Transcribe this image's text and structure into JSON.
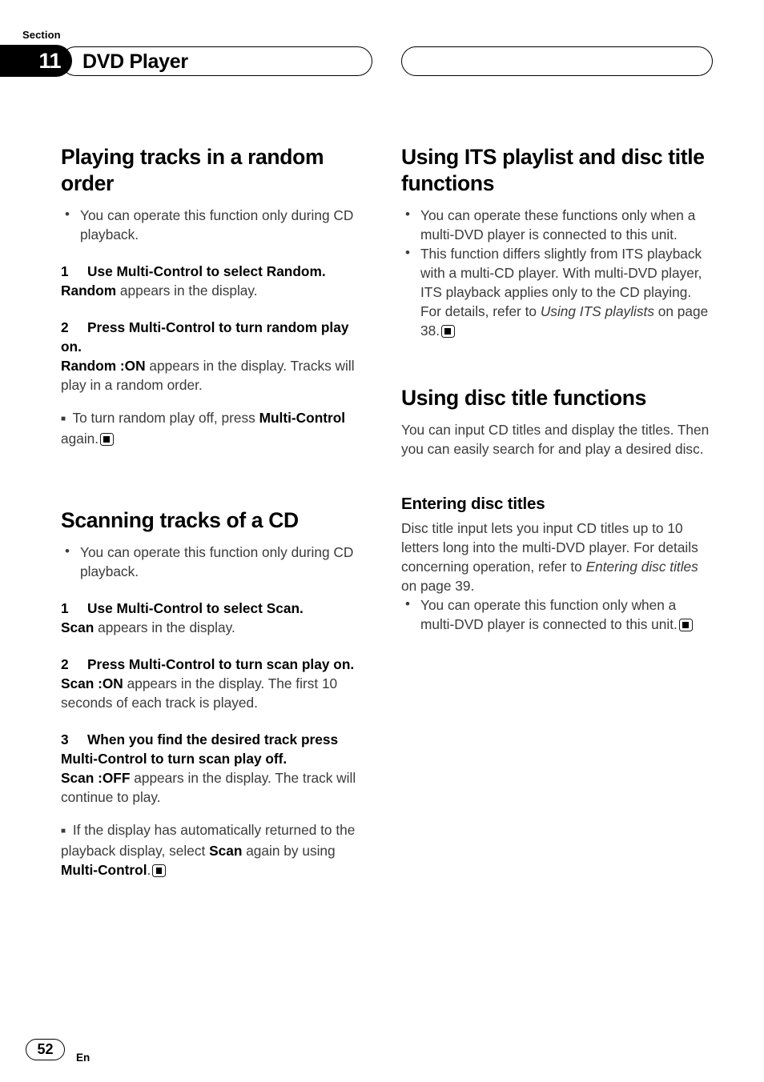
{
  "header": {
    "section_label": "Section",
    "section_number": "11",
    "chapter_title": "DVD Player",
    "right_pill_title": ""
  },
  "footer": {
    "page_number": "52",
    "language_code": "En"
  },
  "left_column": {
    "section1": {
      "heading": "Playing tracks in a random order",
      "bullets": [
        "You can operate this function only during CD playback."
      ],
      "steps": [
        {
          "num": "1",
          "instruction": "Use Multi-Control to select Random.",
          "result_bold": "Random",
          "result_rest": " appears in the display."
        },
        {
          "num": "2",
          "instruction": "Press Multi-Control to turn random play on.",
          "result_bold": "Random :ON",
          "result_rest": " appears in the display. Tracks will play in a random order."
        }
      ],
      "note": {
        "text_before": "To turn random play off, press ",
        "bold": "Multi-Control",
        "text_after": " again."
      }
    },
    "section2": {
      "heading": "Scanning tracks of a CD",
      "bullets": [
        "You can operate this function only during CD playback."
      ],
      "steps": [
        {
          "num": "1",
          "instruction": "Use Multi-Control to select Scan.",
          "result_bold": "Scan",
          "result_rest": " appears in the display."
        },
        {
          "num": "2",
          "instruction": "Press Multi-Control to turn scan play on.",
          "result_bold": "Scan :ON",
          "result_rest": " appears in the display. The first 10 seconds of each track is played."
        },
        {
          "num": "3",
          "instruction": "When you find the desired track press Multi-Control to turn scan play off.",
          "result_bold": "Scan :OFF",
          "result_rest": " appears in the display. The track will continue to play."
        }
      ],
      "note": {
        "text_a": "If the display has automatically returned to the playback display, select ",
        "bold_b": "Scan",
        "text_c": " again by using ",
        "bold_d": "Multi-Control",
        "text_e": "."
      }
    }
  },
  "right_column": {
    "section1": {
      "heading": "Using ITS playlist and disc title functions",
      "bullet1": "You can operate these functions only when a multi-DVD player is connected to this unit.",
      "bullet2_a": "This function differs slightly from ITS playback with a multi-CD player. With multi-DVD player, ITS playback applies only to the CD playing. For details, refer to ",
      "bullet2_italic": "Using ITS playlists",
      "bullet2_b": " on page 38."
    },
    "section2": {
      "heading": "Using disc title functions",
      "intro": "You can input CD titles and display the titles. Then you can easily search for and play a desired disc.",
      "subsection": {
        "heading": "Entering disc titles",
        "body_a": "Disc title input lets you input CD titles up to 10 letters long into the multi-DVD player. For details concerning operation, refer to ",
        "body_italic": "Entering disc titles",
        "body_b": " on page 39.",
        "bullet": "You can operate this function only when a multi-DVD player is connected to this unit."
      }
    }
  },
  "colors": {
    "text": "#000000",
    "body_text": "#3b3b3b",
    "tab_background": "#000000",
    "tab_text": "#ffffff"
  },
  "icons": {
    "end_marker": "end-of-procedure-marker",
    "bullet": "round-bullet",
    "note_bullet": "square-bullet"
  }
}
